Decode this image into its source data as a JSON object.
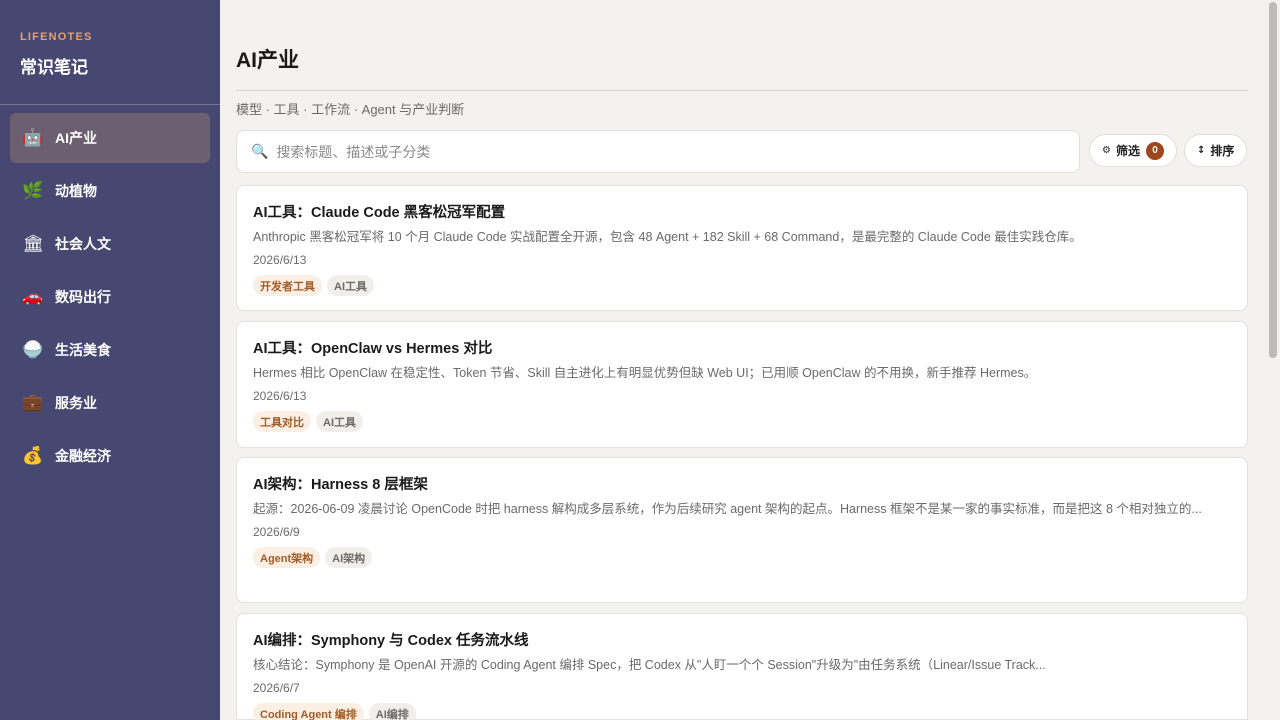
{
  "brand": {
    "en": "LIFENOTES",
    "cn": "常识笔记"
  },
  "sidebar": {
    "items": [
      {
        "icon": "🤖",
        "label": "AI产业",
        "active": true
      },
      {
        "icon": "🌿",
        "label": "动植物"
      },
      {
        "icon": "🏛",
        "label": "社会人文"
      },
      {
        "icon": "🚗",
        "label": "数码出行"
      },
      {
        "icon": "🍚",
        "label": "生活美食"
      },
      {
        "icon": "💼",
        "label": "服务业"
      },
      {
        "icon": "💰",
        "label": "金融经济"
      }
    ]
  },
  "header": {
    "title": "AI产业",
    "subtitle": "模型 · 工具 · 工作流 · Agent 与产业判断"
  },
  "search": {
    "placeholder": "搜索标题、描述或子分类"
  },
  "toolbar": {
    "filter_label": "筛选",
    "filter_count": "0",
    "sort_label": "排序"
  },
  "cards": [
    {
      "title": "AI工具：Claude Code 黑客松冠军配置",
      "desc": "Anthropic 黑客松冠军将 10 个月 Claude Code 实战配置全开源，包含 48 Agent + 182 Skill + 68 Command，是最完整的 Claude Code 最佳实践仓库。",
      "date": "2026/6/13",
      "tags": [
        "开发者工具",
        "AI工具"
      ]
    },
    {
      "title": "AI工具：OpenClaw vs Hermes 对比",
      "desc": "Hermes 相比 OpenClaw 在稳定性、Token 节省、Skill 自主进化上有明显优势但缺 Web UI；已用顺 OpenClaw 的不用换，新手推荐 Hermes。",
      "date": "2026/6/13",
      "tags": [
        "工具对比",
        "AI工具"
      ]
    },
    {
      "title": "AI架构：Harness 8 层框架",
      "desc": "起源：2026-06-09 凌晨讨论 OpenCode 时把 harness 解构成多层系统，作为后续研究 agent 架构的起点。Harness 框架不是某一家的事实标准，而是把这 8 个相对独立的...",
      "date": "2026/6/9",
      "tags": [
        "Agent架构",
        "AI架构"
      ]
    },
    {
      "title": "AI编排：Symphony 与 Codex 任务流水线",
      "desc": "核心结论：Symphony 是 OpenAI 开源的 Coding Agent 编排 Spec，把 Codex 从\"人盯一个个 Session\"升级为\"由任务系统（Linear/Issue Track...",
      "date": "2026/6/7",
      "tags": [
        "Coding Agent 编排",
        "AI编排"
      ]
    }
  ]
}
